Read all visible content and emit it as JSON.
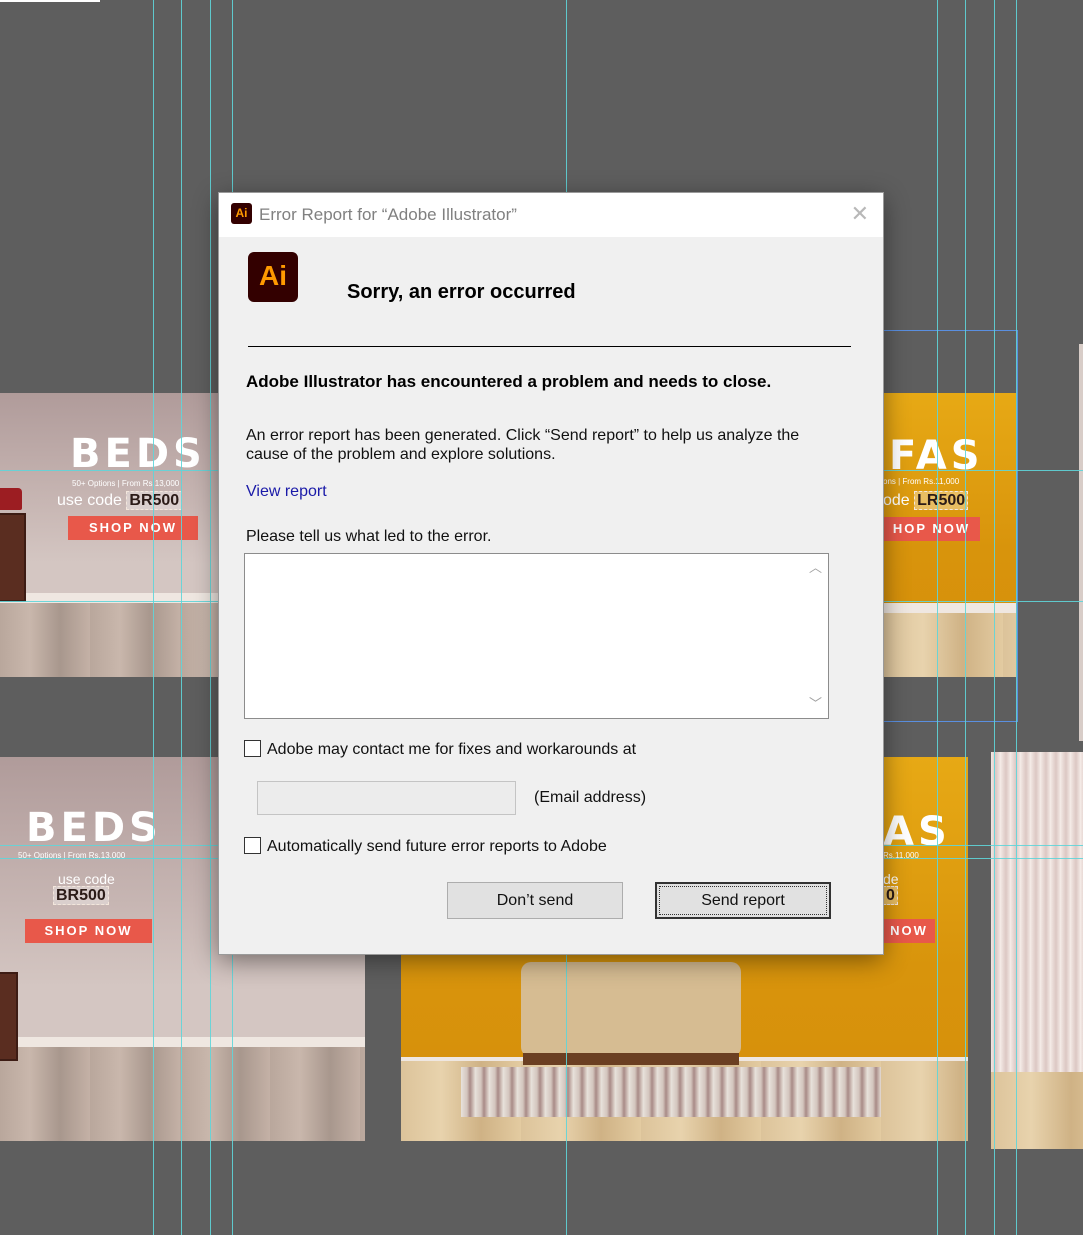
{
  "background": {
    "canvas_color": "#5e5e5e",
    "guide_color": "#5fd5d9",
    "artboards": {
      "beds_top": {
        "headline": "BEDS",
        "sub": "50+ Options | From Rs.13,000",
        "code_prefix": "use code",
        "code": "BR500",
        "cta": "SHOP NOW"
      },
      "sofas_top": {
        "headline": "FAS",
        "sub": "ons | From Rs.11,000",
        "code_prefix": "ode",
        "code": "LR500",
        "cta": "HOP NOW"
      },
      "beds_bottom": {
        "headline": "BEDS",
        "sub": "50+ Options | From Rs.13,000",
        "code_prefix": "use code",
        "code": "BR500",
        "cta": "SHOP NOW"
      },
      "sofas_bottom": {
        "headline": "AS",
        "sub": "Rs.11,000",
        "code_prefix": "de",
        "code": "0",
        "cta": "NOW"
      }
    }
  },
  "dialog": {
    "title": "Error Report for “Adobe Illustrator”",
    "app_icon_text": "Ai",
    "close_glyph": "✕",
    "heading": "Sorry, an error occurred",
    "problem": "Adobe Illustrator has encountered a problem and needs to close.",
    "description": "An error report has been generated. Click “Send report” to help us analyze the cause of the problem and explore solutions.",
    "view_report": "View report",
    "tell_us_label": "Please tell us what led to the error.",
    "comment_value": "",
    "contact_label": "Adobe may contact me for fixes and workarounds at",
    "contact_checked": false,
    "email_value": "",
    "email_label": "(Email address)",
    "auto_send_label": "Automatically send future error reports to Adobe",
    "auto_send_checked": false,
    "dont_send": "Don’t send",
    "send_report": "Send report",
    "icon_colors": {
      "bg": "#330000",
      "fg": "#ff9a00"
    }
  }
}
